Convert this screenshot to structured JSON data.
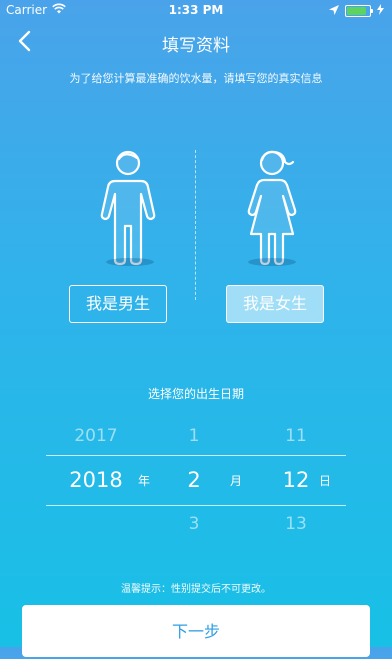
{
  "status_bar": {
    "carrier": "Carrier",
    "time": "1:33 PM",
    "battery_level": 0.95
  },
  "nav": {
    "title": "填写资料"
  },
  "subtitle": "为了给您计算最准确的饮水量，请填写您的真实信息",
  "gender": {
    "male_label": "我是男生",
    "female_label": "我是女生",
    "selected": "female"
  },
  "dob": {
    "label": "选择您的出生日期",
    "year": {
      "prev": "2017",
      "selected": "2018",
      "next": "",
      "unit": "年"
    },
    "month": {
      "prev": "1",
      "selected": "2",
      "next": "3",
      "unit": "月"
    },
    "day": {
      "prev": "11",
      "selected": "12",
      "next": "13",
      "unit": "日"
    }
  },
  "tip": "温馨提示：性别提交后不可更改。",
  "next_button": "下一步",
  "colors": {
    "accent": "#2e9fe3",
    "bg_top": "#4aa3ea",
    "bg_bottom": "#18c0e6"
  }
}
